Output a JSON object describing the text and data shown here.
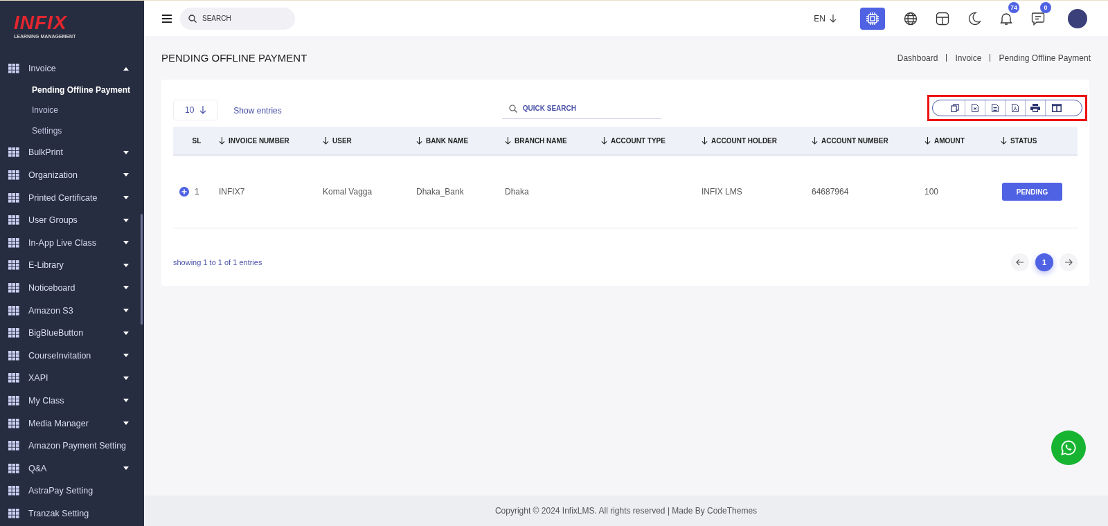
{
  "logo": {
    "title": "INFIX",
    "subtitle": "LEARNING MANAGEMENT"
  },
  "sidebar": {
    "items": [
      {
        "label": "Invoice",
        "expandable": true,
        "expanded": true,
        "children": [
          {
            "label": "Pending Offline Payment",
            "selected": true
          },
          {
            "label": "Invoice",
            "selected": false
          },
          {
            "label": "Settings",
            "selected": false
          }
        ]
      },
      {
        "label": "BulkPrint",
        "expandable": true,
        "expanded": false
      },
      {
        "label": "Organization",
        "expandable": true,
        "expanded": false
      },
      {
        "label": "Printed Certificate",
        "expandable": true,
        "expanded": false
      },
      {
        "label": "User Groups",
        "expandable": true,
        "expanded": false
      },
      {
        "label": "In-App Live Class",
        "expandable": true,
        "expanded": false
      },
      {
        "label": "E-Library",
        "expandable": true,
        "expanded": false
      },
      {
        "label": "Noticeboard",
        "expandable": true,
        "expanded": false
      },
      {
        "label": "Amazon S3",
        "expandable": true,
        "expanded": false
      },
      {
        "label": "BigBlueButton",
        "expandable": true,
        "expanded": false
      },
      {
        "label": "CourseInvitation",
        "expandable": true,
        "expanded": false
      },
      {
        "label": "XAPI",
        "expandable": true,
        "expanded": false
      },
      {
        "label": "My Class",
        "expandable": true,
        "expanded": false
      },
      {
        "label": "Media Manager",
        "expandable": true,
        "expanded": false
      },
      {
        "label": "Amazon Payment Setting",
        "expandable": false,
        "expanded": false
      },
      {
        "label": "Q&A",
        "expandable": true,
        "expanded": false
      },
      {
        "label": "AstraPay Setting",
        "expandable": false,
        "expanded": false
      },
      {
        "label": "Tranzak Setting",
        "expandable": false,
        "expanded": false
      }
    ]
  },
  "header": {
    "search": {
      "placeholder": "SEARCH"
    },
    "language": "EN",
    "notifications": "74",
    "messages": "0"
  },
  "page": {
    "title": "PENDING OFFLINE PAYMENT",
    "breadcrumbs": [
      "Dashboard",
      "Invoice",
      "Pending Offline Payment"
    ]
  },
  "table_controls": {
    "page_size": "10",
    "page_size_label": "Show entries",
    "quick_search": {
      "placeholder": "QUICK SEARCH"
    }
  },
  "export_toolbar": {
    "highlighted": true,
    "buttons": [
      {
        "kind": "copy"
      },
      {
        "kind": "excel"
      },
      {
        "kind": "csv"
      },
      {
        "kind": "pdf"
      },
      {
        "kind": "print"
      },
      {
        "kind": "columns"
      }
    ]
  },
  "table": {
    "columns": [
      {
        "label": "SL",
        "sortable": false
      },
      {
        "label": "INVOICE NUMBER",
        "sortable": true
      },
      {
        "label": "USER",
        "sortable": true
      },
      {
        "label": "BANK NAME",
        "sortable": true
      },
      {
        "label": "BRANCH NAME",
        "sortable": true
      },
      {
        "label": "ACCOUNT TYPE",
        "sortable": true
      },
      {
        "label": "ACCOUNT HOLDER",
        "sortable": true
      },
      {
        "label": "ACCOUNT NUMBER",
        "sortable": true
      },
      {
        "label": "AMOUNT",
        "sortable": true
      },
      {
        "label": "STATUS",
        "sortable": true
      }
    ],
    "rows": [
      {
        "cells": [
          "1",
          "INFIX7",
          "Komal Vagga",
          "Dhaka_Bank",
          "Dhaka",
          null,
          "INFIX LMS",
          "64687964",
          "100",
          "PENDING"
        ]
      }
    ]
  },
  "entries_info": "showing 1 to 1 of 1 entries",
  "pagination": {
    "pages": [
      {
        "label": "1",
        "selected": true
      }
    ]
  },
  "footer": "Copyright © 2024 InfixLMS. All rights reserved | Made By CodeThemes"
}
